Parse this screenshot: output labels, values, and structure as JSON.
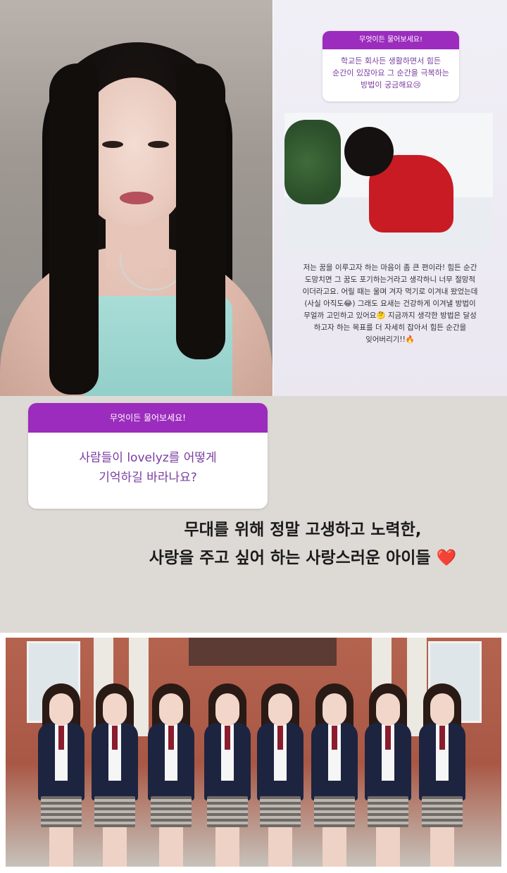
{
  "story_top": {
    "question_header": "무엇이든 물어보세요!",
    "question_text": "학교든 회사든 생활하면서 힘든\n순간이 있잖아요 그 순간을 극복하는\n방법이 궁금해요😢",
    "answer_text": "저는 꿈을 이루고자 하는 마음이 좀 큰 편이라! 힘든 순간\n도망치면 그 꿈도 포기하는거라고 생각하니 너무 절망적\n이더라고요. 어릴 때는 울며 겨자 먹기로 이겨내 왔었는데\n(사실 아직도😂) 그래도 요새는 건강하게 이겨낼 방법이\n무얼까 고민하고 있어요🤔 지금까지 생각한 방법은 달성\n하고자 하는 목표를 더 자세히 잡아서 힘든 순간을\n잊어버리기!!🔥"
  },
  "story_middle": {
    "question_header": "무엇이든 물어보세요!",
    "question_text": "사람들이 lovelyz를 어떻게\n기억하길 바라나요?",
    "answer_line_1": "무대를 위해 정말 고생하고 노력한,",
    "answer_line_2": "사랑을 주고 싶어 하는 사랑스러운 아이들",
    "answer_emoji": "❤️"
  },
  "colors": {
    "question_header_bg": "#9b2cbd",
    "question_text": "#7a3ca0",
    "middle_bg": "#dddad6"
  }
}
